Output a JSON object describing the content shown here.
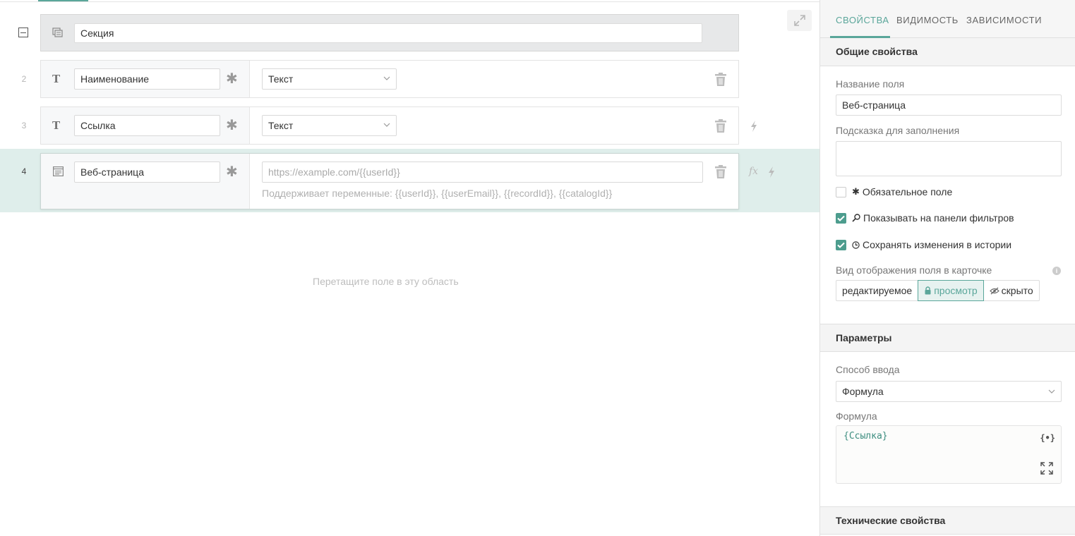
{
  "canvas": {
    "section": {
      "label": "Секция"
    },
    "rows": [
      {
        "num": "2",
        "name": "Наименование",
        "type": "Текст"
      },
      {
        "num": "3",
        "name": "Ссылка",
        "type": "Текст"
      },
      {
        "num": "4",
        "name": "Веб-страница",
        "url_placeholder": "https://example.com/{{userId}}",
        "hint": "Поддерживает переменные: {{userId}}, {{userEmail}}, {{recordId}}, {{catalogId}}",
        "fx": "fx"
      }
    ],
    "drop_zone": "Перетащите поле в эту область"
  },
  "panel": {
    "tabs": [
      "СВОЙСТВА",
      "ВИДИМОСТЬ",
      "ЗАВИСИМОСТИ"
    ],
    "general": {
      "title": "Общие свойства",
      "field_name_label": "Название поля",
      "field_name_value": "Веб-страница",
      "hint_label": "Подсказка для заполнения",
      "hint_value": "",
      "required_label": "Обязательное поле",
      "required_checked": false,
      "filters_label": "Показывать на панели фильтров",
      "filters_checked": true,
      "history_label": "Сохранять изменения в истории",
      "history_checked": true,
      "display_label": "Вид отображения поля в карточке",
      "display_options": [
        "редактируемое",
        "просмотр",
        "скрыто"
      ],
      "display_selected": "просмотр"
    },
    "params": {
      "title": "Параметры",
      "input_method_label": "Способ ввода",
      "input_method_value": "Формула",
      "formula_label": "Формула",
      "formula_value": "{Ссылка}",
      "braces_glyph": "{•}"
    },
    "technical": {
      "title": "Технические свойства"
    }
  },
  "colors": {
    "accent": "#5aa69a",
    "active_row_bg": "#dfeeeb",
    "checkbox": "#4d9d8e"
  }
}
